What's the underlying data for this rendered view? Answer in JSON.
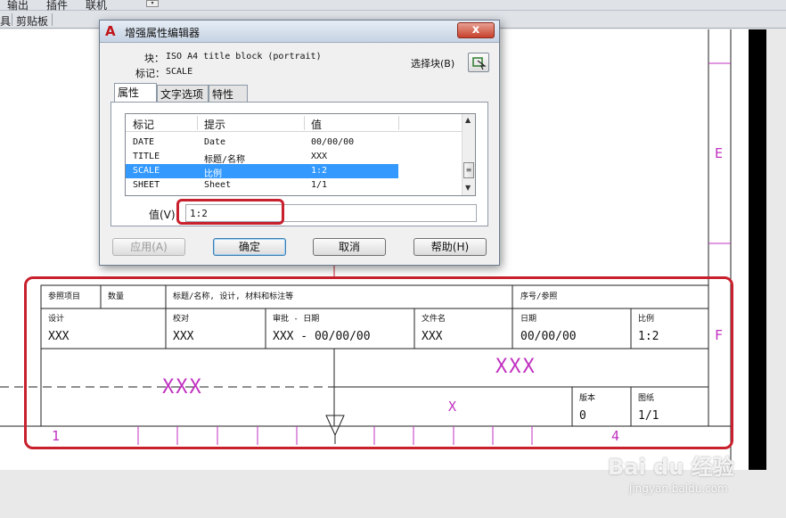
{
  "ribbon": {
    "tabs": [
      "输出",
      "插件",
      "联机"
    ],
    "panel_label": "剪贴板",
    "panel_prefix": "具"
  },
  "dialog": {
    "title": "增强属性编辑器",
    "close_label": "x",
    "block_label": "块：",
    "block_value": "ISO A4 title block (portrait)",
    "tag_label": "标记：",
    "tag_value": "SCALE",
    "select_block_label": "选择块(B)",
    "tabs": [
      "属性",
      "文字选项",
      "特性"
    ],
    "columns": [
      "标记",
      "提示",
      "值"
    ],
    "rows": [
      {
        "tag": "DATE",
        "prompt": "Date",
        "value": "00/00/00"
      },
      {
        "tag": "TITLE",
        "prompt": "标题/名称",
        "value": "XXX"
      },
      {
        "tag": "SCALE",
        "prompt": "比例",
        "value": "1:2"
      },
      {
        "tag": "SHEET",
        "prompt": "Sheet",
        "value": "1/1"
      }
    ],
    "value_label": "值(V)",
    "value_input": "1:2",
    "buttons": {
      "apply": "应用(A)",
      "ok": "确定",
      "cancel": "取消",
      "help": "帮助(H)"
    }
  },
  "title_block": {
    "ref": "参照项目",
    "qty": "数量",
    "title_hdr": "标题/名称, 设计, 材料和标注等",
    "serial": "序号/参照",
    "designer_lbl": "设计",
    "designer_val": "XXX",
    "checker_lbl": "校对",
    "checker_val": "XXX",
    "approve_lbl": "审批 - 日期",
    "approve_val": "XXX - 00/00/00",
    "file_lbl": "文件名",
    "file_val": "XXX",
    "date_lbl": "日期",
    "date_val": "00/00/00",
    "scale_lbl": "比例",
    "scale_val": "1:2",
    "big_title": "XXX",
    "left_title": "XXX",
    "x_mark": "X",
    "rev_lbl": "版本",
    "rev_val": "0",
    "sheet_lbl": "图纸",
    "sheet_val": "1/1",
    "zone_1": "1",
    "zone_4": "4",
    "zone_e": "E",
    "zone_f": "F"
  },
  "watermark": {
    "logo": "Bai du 经验",
    "url": "jingyan.baidu.com"
  },
  "colors": {
    "accent_red": "#c8202d",
    "selection": "#3399ff",
    "magenta": "#c030c0"
  }
}
